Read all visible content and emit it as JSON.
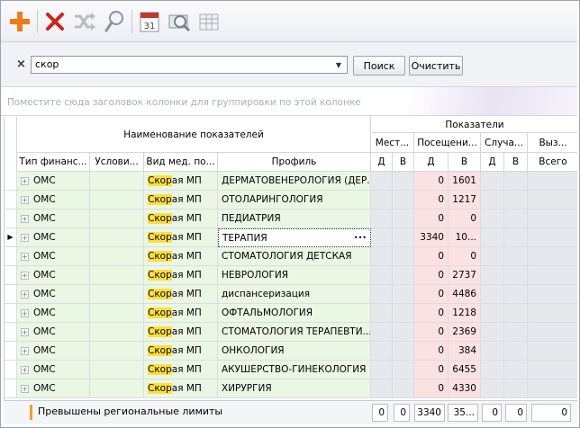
{
  "toolbar": {
    "buttons": [
      {
        "name": "add-icon",
        "color": "#f07a18"
      },
      {
        "name": "delete-icon",
        "color": "#d0231a"
      },
      {
        "name": "shuffle-icon",
        "color": "#b8bcc4"
      },
      {
        "name": "search-icon",
        "color": "#8a93a0"
      },
      {
        "name": "calendar-icon",
        "label": "31",
        "color": "#c0392b"
      },
      {
        "name": "preview-icon",
        "color": "#8a93a0"
      },
      {
        "name": "table-icon",
        "color": "#a7adb6"
      }
    ]
  },
  "search": {
    "close_label": "×",
    "value": "скор",
    "search_button": "Поиск",
    "clear_button": "Очистить"
  },
  "group_panel": {
    "hint": "Поместите сюда заголовок колонки для группировки по этой колонке"
  },
  "grid": {
    "band_names": "Наименование показателей",
    "band_indicators": "Показатели",
    "sub_bands": [
      "Мест...",
      "Посещени...",
      "Случа...",
      "Выз..."
    ],
    "columns": {
      "fin": "Тип финанс...",
      "cond": "Услови...",
      "vid": "Вид мед. по...",
      "profile": "Профиль",
      "d1": "Д",
      "v1": "В",
      "d2": "Д",
      "v2": "В",
      "d3": "Д",
      "v3": "В",
      "all": "Всего"
    },
    "vid_highlight": "Скор",
    "vid_rest": "ая МП",
    "rows": [
      {
        "fin": "ОМС",
        "profile": "ДЕРМАТОВЕНЕРОЛОГИЯ (ДЕР...",
        "d2": "0",
        "v2": "1601"
      },
      {
        "fin": "ОМС",
        "profile": "ОТОЛАРИНГОЛОГИЯ",
        "d2": "0",
        "v2": "1217"
      },
      {
        "fin": "ОМС",
        "profile": "ПЕДИАТРИЯ",
        "d2": "0",
        "v2": "0"
      },
      {
        "fin": "ОМС",
        "profile": "ТЕРАПИЯ",
        "d2": "3340",
        "v2": "10...",
        "ellipsis": "•••"
      },
      {
        "fin": "ОМС",
        "profile": "СТОМАТОЛОГИЯ ДЕТСКАЯ",
        "d2": "0",
        "v2": "0"
      },
      {
        "fin": "ОМС",
        "profile": "НЕВРОЛОГИЯ",
        "d2": "0",
        "v2": "2737"
      },
      {
        "fin": "ОМС",
        "profile": "диспансеризация",
        "d2": "0",
        "v2": "4486"
      },
      {
        "fin": "ОМС",
        "profile": "ОФТАЛЬМОЛОГИЯ",
        "d2": "0",
        "v2": "1218"
      },
      {
        "fin": "ОМС",
        "profile": "СТОМАТОЛОГИЯ ТЕРАПЕВТИ...",
        "d2": "0",
        "v2": "2369"
      },
      {
        "fin": "ОМС",
        "profile": "ОНКОЛОГИЯ",
        "d2": "0",
        "v2": "384"
      },
      {
        "fin": "ОМС",
        "profile": "АКУШЕРСТВО-ГИНЕКОЛОГИЯ",
        "d2": "0",
        "v2": "6455"
      },
      {
        "fin": "ОМС",
        "profile": "ХИРУРГИЯ",
        "d2": "0",
        "v2": "4330"
      }
    ]
  },
  "footer": {
    "limit_text": "Превышены региональные лимиты",
    "totals": [
      "0",
      "0",
      "3340",
      "35...",
      "0",
      "0",
      "0"
    ]
  }
}
